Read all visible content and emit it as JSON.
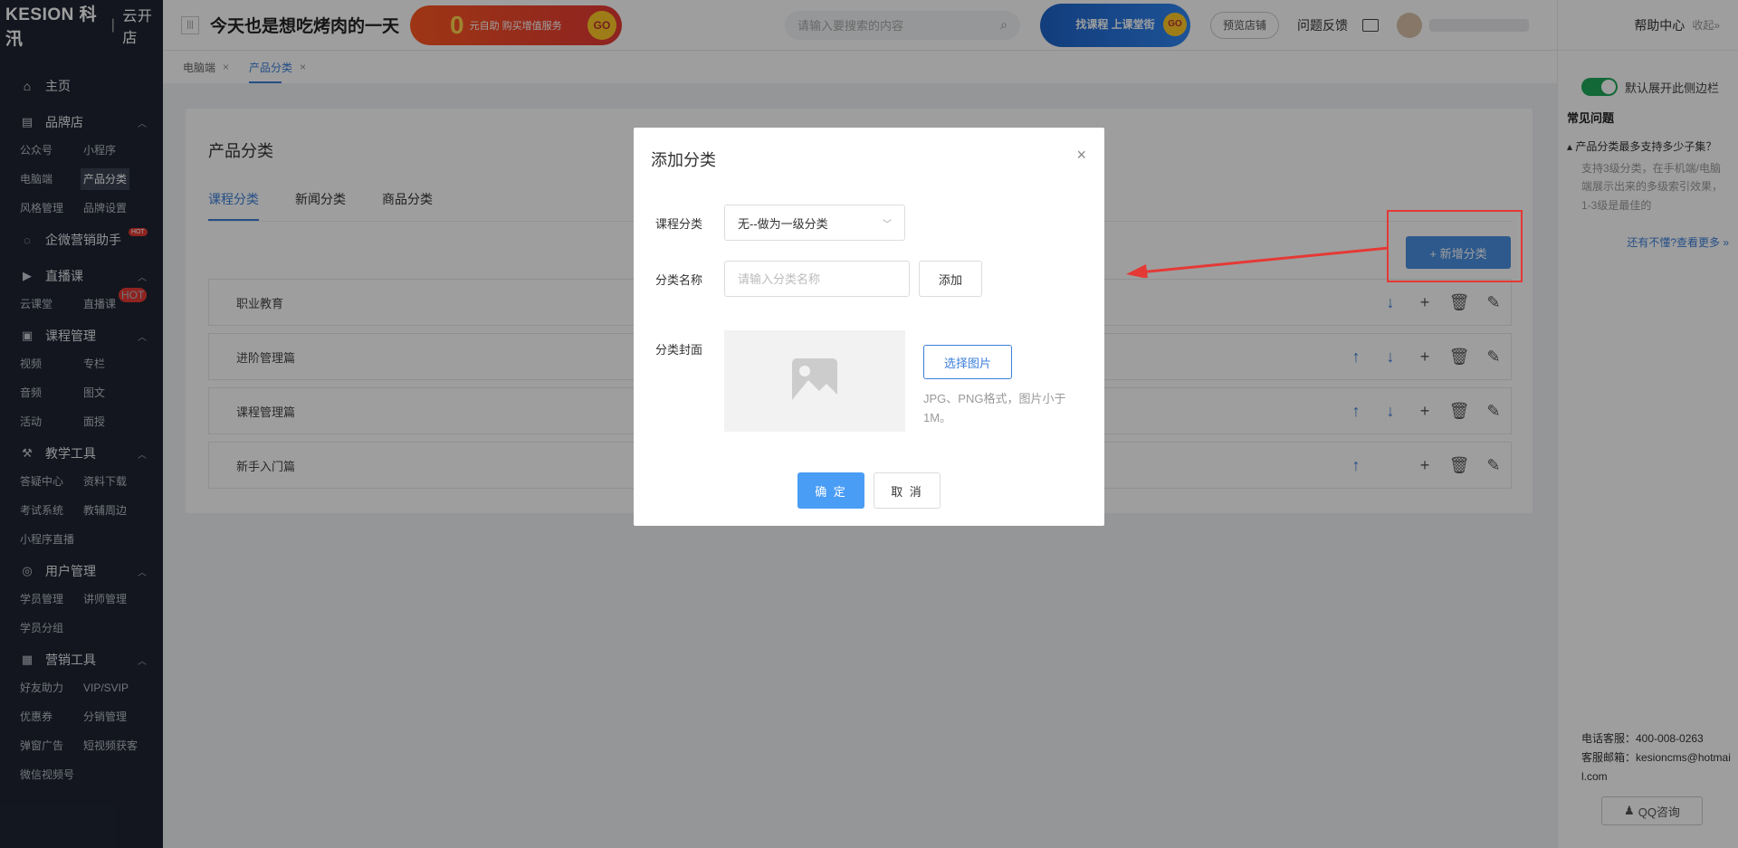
{
  "logo": {
    "brand": "KESION 科汛",
    "store": "云开店"
  },
  "sidebar": {
    "home": "主页",
    "groups": [
      {
        "title": "品牌店",
        "items": [
          "公众号",
          "小程序",
          "电脑端",
          "产品分类",
          "风格管理",
          "品牌设置"
        ]
      },
      {
        "title": "企微营销助手",
        "items": []
      },
      {
        "title": "直播课",
        "items": [
          "云课堂",
          "直播课"
        ]
      },
      {
        "title": "课程管理",
        "items": [
          "视频",
          "专栏",
          "音频",
          "图文",
          "活动",
          "面授"
        ]
      },
      {
        "title": "教学工具",
        "items": [
          "答疑中心",
          "资料下载",
          "考试系统",
          "教辅周边",
          "小程序直播"
        ]
      },
      {
        "title": "用户管理",
        "items": [
          "学员管理",
          "讲师管理",
          "学员分组"
        ]
      },
      {
        "title": "营销工具",
        "items": [
          "好友助力",
          "VIP/SVIP",
          "优惠券",
          "分销管理",
          "弹窗广告",
          "短视频获客",
          "微信视频号"
        ]
      }
    ],
    "hot_badge": "HOT"
  },
  "topbar": {
    "slogan": "今天也是想吃烤肉的一天",
    "promo_zero": "0",
    "promo_text": "元自助 购买增值服务",
    "promo_go": "GO",
    "search_placeholder": "请输入要搜索的内容",
    "course_banner": "找课程 上课堂街",
    "course_go": "GO",
    "preview_btn": "预览店铺",
    "feedback": "问题反馈"
  },
  "crumbs": [
    {
      "label": "电脑端",
      "close": "×"
    },
    {
      "label": "产品分类",
      "close": "×"
    }
  ],
  "card": {
    "title": "产品分类",
    "tabs": [
      "课程分类",
      "新闻分类",
      "商品分类"
    ],
    "add_button": "+ 新增分类",
    "rows": [
      "职业教育",
      "进阶管理篇",
      "课程管理篇",
      "新手入门篇"
    ]
  },
  "rpanel": {
    "help": "帮助中心",
    "collapse": "收起»",
    "toggle_label": "默认展开此侧边栏",
    "faq_title": "常见问题",
    "faq_q": "▴ 产品分类最多支持多少子集？",
    "faq_a": "支持3级分类，在手机端/电脑端展示出来的多级索引效果，1-3级是最佳的",
    "faq_more": "还有不懂?查看更多 »",
    "phone": "电话客服：400-008-0263",
    "email": "客服邮箱：kesioncms@hotmail.com",
    "qq": "QQ咨询"
  },
  "modal": {
    "title": "添加分类",
    "close": "×",
    "label_category": "课程分类",
    "select_value": "无--做为一级分类",
    "label_name": "分类名称",
    "name_placeholder": "请输入分类名称",
    "add_inline": "添加",
    "label_cover": "分类封面",
    "choose_image": "选择图片",
    "hint": "JPG、PNG格式，图片小于1M。",
    "ok": "确 定",
    "cancel": "取 消"
  },
  "colors": {
    "accent": "#3b7fd9",
    "sidebar": "#1f2533",
    "highlight": "#e53935"
  }
}
